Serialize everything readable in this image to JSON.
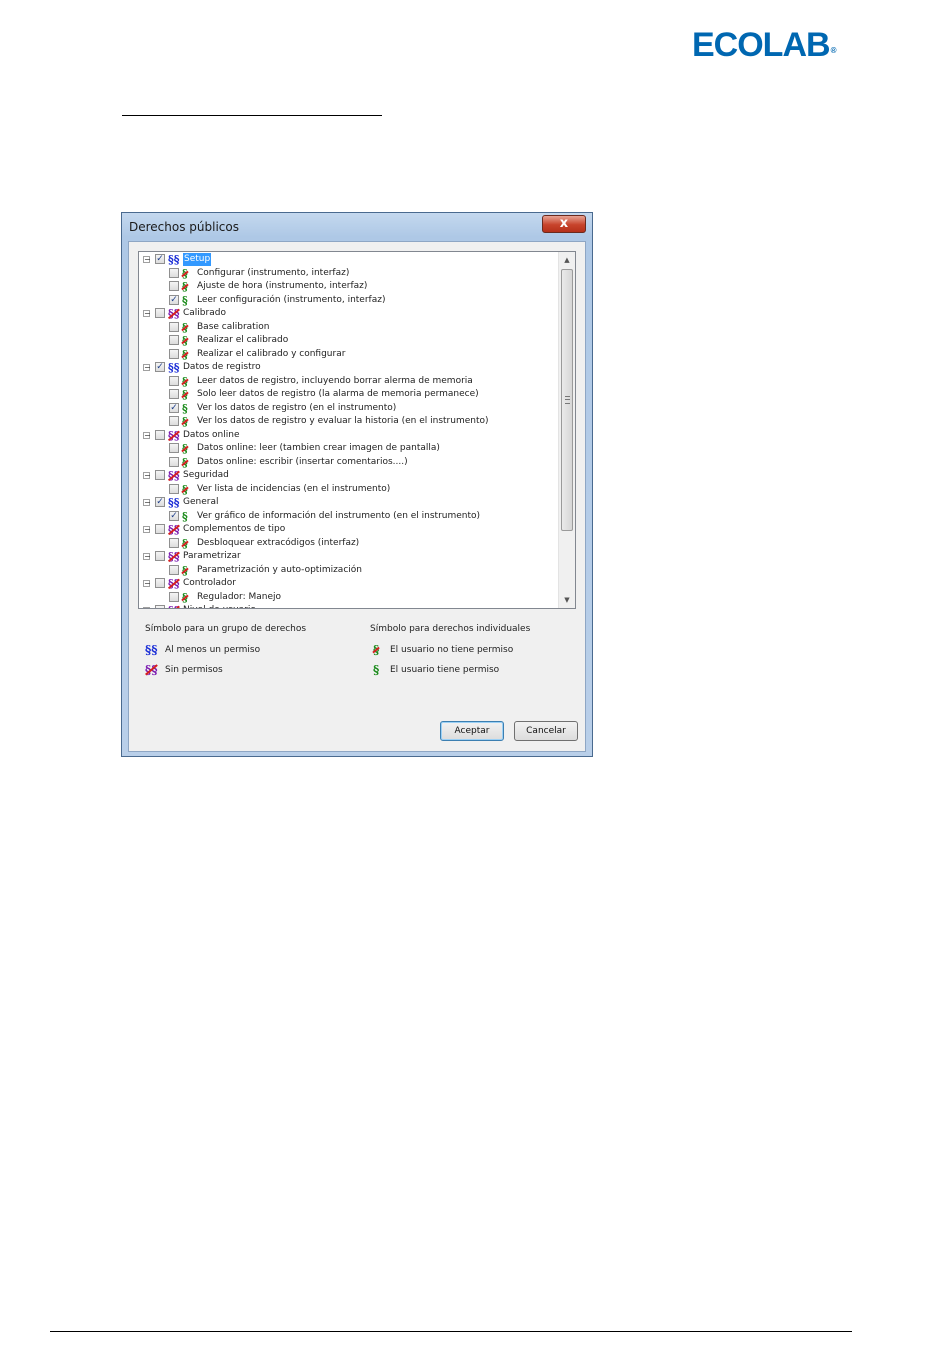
{
  "brand": {
    "logo_text": "ECOLAB",
    "logo_mark": "®",
    "color": "#0067b1"
  },
  "dialog": {
    "title": "Derechos públicos",
    "close_label": "x",
    "tree": [
      {
        "label": "Setup",
        "kind": "group",
        "symbol": "§§",
        "perm": "partial",
        "checked": true,
        "selected": true,
        "expander": "−"
      },
      {
        "label": "Configurar (instrumento, interfaz)",
        "kind": "item",
        "symbol": "§",
        "perm": "no",
        "checked": false
      },
      {
        "label": "Ajuste de hora (instrumento, interfaz)",
        "kind": "item",
        "symbol": "§",
        "perm": "no",
        "checked": false
      },
      {
        "label": "Leer configuración (instrumento, interfaz)",
        "kind": "item",
        "symbol": "§",
        "perm": "yes",
        "checked": true
      },
      {
        "label": "Calibrado",
        "kind": "group",
        "symbol": "§§",
        "perm": "none",
        "checked": false,
        "expander": "−"
      },
      {
        "label": "Base calibration",
        "kind": "item",
        "symbol": "§",
        "perm": "no",
        "checked": false
      },
      {
        "label": "Realizar el calibrado",
        "kind": "item",
        "symbol": "§",
        "perm": "no",
        "checked": false
      },
      {
        "label": "Realizar el calibrado y configurar",
        "kind": "item",
        "symbol": "§",
        "perm": "no",
        "checked": false
      },
      {
        "label": "Datos de registro",
        "kind": "group",
        "symbol": "§§",
        "perm": "partial",
        "checked": true,
        "expander": "−"
      },
      {
        "label": "Leer datos de registro, incluyendo borrar alerma de memoria",
        "kind": "item",
        "symbol": "§",
        "perm": "no",
        "checked": false
      },
      {
        "label": "Solo leer datos de registro (la alarma de memoria permanece)",
        "kind": "item",
        "symbol": "§",
        "perm": "no",
        "checked": false
      },
      {
        "label": "Ver los datos de registro (en el instrumento)",
        "kind": "item",
        "symbol": "§",
        "perm": "yes",
        "checked": true
      },
      {
        "label": "Ver los datos de registro y evaluar la historia (en el instrumento)",
        "kind": "item",
        "symbol": "§",
        "perm": "no",
        "checked": false
      },
      {
        "label": "Datos online",
        "kind": "group",
        "symbol": "§§",
        "perm": "none",
        "checked": false,
        "expander": "−"
      },
      {
        "label": "Datos online: leer (tambien crear imagen de pantalla)",
        "kind": "item",
        "symbol": "§",
        "perm": "no",
        "checked": false
      },
      {
        "label": "Datos online: escribir (insertar comentarios....)",
        "kind": "item",
        "symbol": "§",
        "perm": "no",
        "checked": false
      },
      {
        "label": "Seguridad",
        "kind": "group",
        "symbol": "§§",
        "perm": "none",
        "checked": false,
        "expander": "−"
      },
      {
        "label": "Ver lista de incidencias (en el instrumento)",
        "kind": "item",
        "symbol": "§",
        "perm": "no",
        "checked": false
      },
      {
        "label": "General",
        "kind": "group",
        "symbol": "§§",
        "perm": "partial",
        "checked": true,
        "expander": "−"
      },
      {
        "label": "Ver gráfico de información del instrumento (en el instrumento)",
        "kind": "item",
        "symbol": "§",
        "perm": "yes",
        "checked": true
      },
      {
        "label": "Complementos de tipo",
        "kind": "group",
        "symbol": "§§",
        "perm": "none",
        "checked": false,
        "expander": "−"
      },
      {
        "label": "Desbloquear extracódigos (interfaz)",
        "kind": "item",
        "symbol": "§",
        "perm": "no",
        "checked": false
      },
      {
        "label": "Parametrizar",
        "kind": "group",
        "symbol": "§§",
        "perm": "none",
        "checked": false,
        "expander": "−"
      },
      {
        "label": "Parametrización y auto-optimización",
        "kind": "item",
        "symbol": "§",
        "perm": "no",
        "checked": false
      },
      {
        "label": "Controlador",
        "kind": "group",
        "symbol": "§§",
        "perm": "none",
        "checked": false,
        "expander": "−"
      },
      {
        "label": "Regulador: Manejo",
        "kind": "item",
        "symbol": "§",
        "perm": "no",
        "checked": false
      },
      {
        "label": "Nivel de usuario",
        "kind": "group",
        "symbol": "§§",
        "perm": "none",
        "checked": false,
        "expander": "−"
      }
    ],
    "legend": {
      "group_heading": "Símbolo para un grupo de derechos",
      "group_partial": "Al menos un permiso",
      "group_none": "Sin permisos",
      "individual_heading": "Símbolo para derechos individuales",
      "individual_no": "El usuario no tiene permiso",
      "individual_yes": "El usuario tiene permiso"
    },
    "buttons": {
      "ok": "Aceptar",
      "cancel": "Cancelar"
    }
  }
}
